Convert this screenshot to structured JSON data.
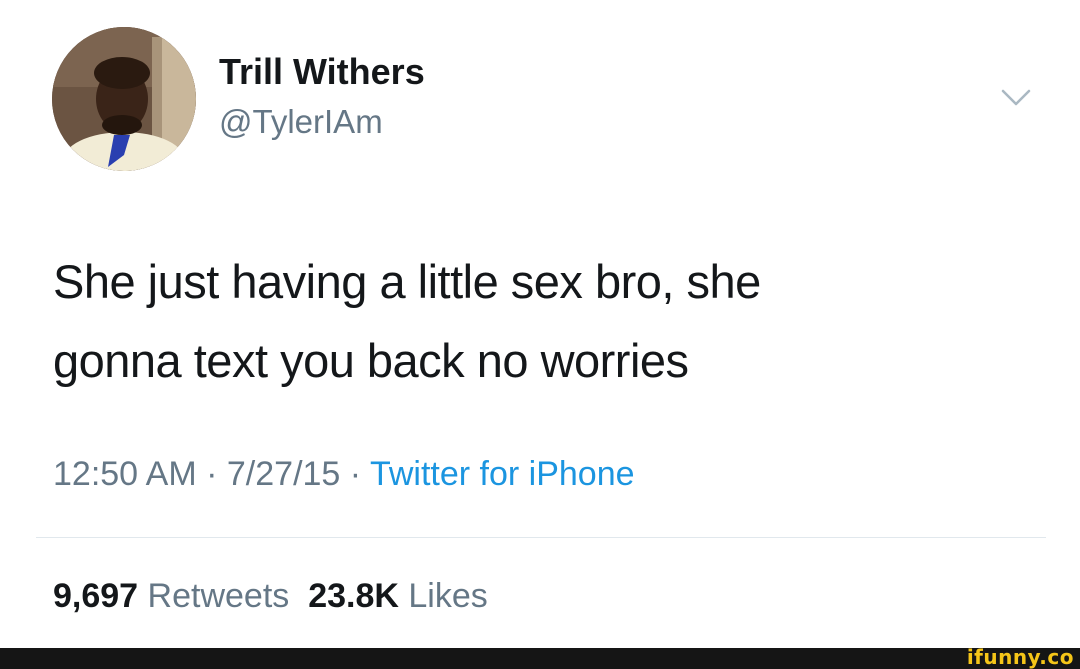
{
  "user": {
    "display_name": "Trill Withers",
    "handle": "@TylerIAm"
  },
  "tweet": {
    "text_lines": [
      "She just having a little sex bro, she",
      "gonna text you back no worries"
    ],
    "time": "12:50 AM",
    "date": "7/27/15",
    "separator": "·",
    "source": "Twitter for iPhone"
  },
  "stats": {
    "retweets_count": "9,697",
    "retweets_label": "Retweets",
    "likes_count": "23.8K",
    "likes_label": "Likes"
  },
  "icons": {
    "menu": "chevron-down-icon"
  },
  "watermark": "ifunny.co",
  "colors": {
    "text_primary": "#14171a",
    "text_secondary": "#657786",
    "link": "#1b95e0",
    "divider": "#e1e8ed",
    "watermark": "#f5c518"
  }
}
